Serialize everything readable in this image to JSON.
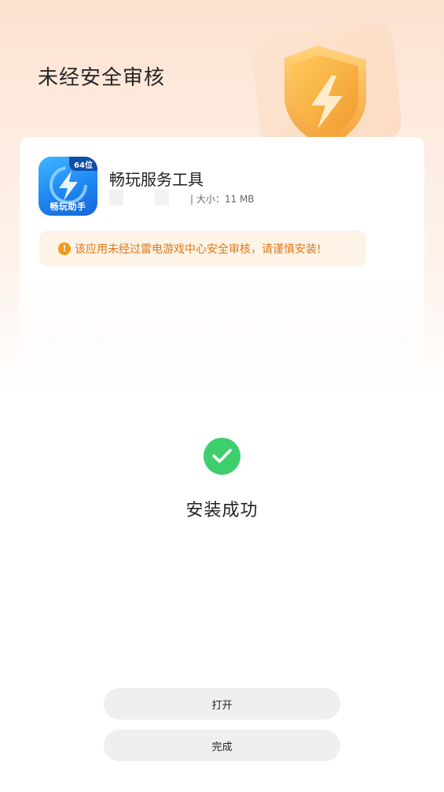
{
  "header": {
    "title": "未经安全审核"
  },
  "app": {
    "name": "畅玩服务工具",
    "size_label": "| 大小：11 MB",
    "icon_badge": "64位",
    "icon_caption": "畅玩助手"
  },
  "warning": {
    "text": "该应用未经过雷电游戏中心安全审核，请谨慎安装!"
  },
  "status": {
    "text": "安装成功"
  },
  "buttons": {
    "open_label": "打开",
    "done_label": "完成"
  },
  "colors": {
    "success_green": "#3dcf6b",
    "warning_orange": "#e0771a",
    "warning_bg": "#fdf3e6",
    "app_icon_blue": "#1f86f2",
    "button_bg": "#efefef"
  },
  "icons": {
    "shield": "shield-lightning-icon",
    "app": "app-lightning-icon",
    "warning": "exclamation-circle-icon",
    "success": "checkmark-circle-icon"
  }
}
